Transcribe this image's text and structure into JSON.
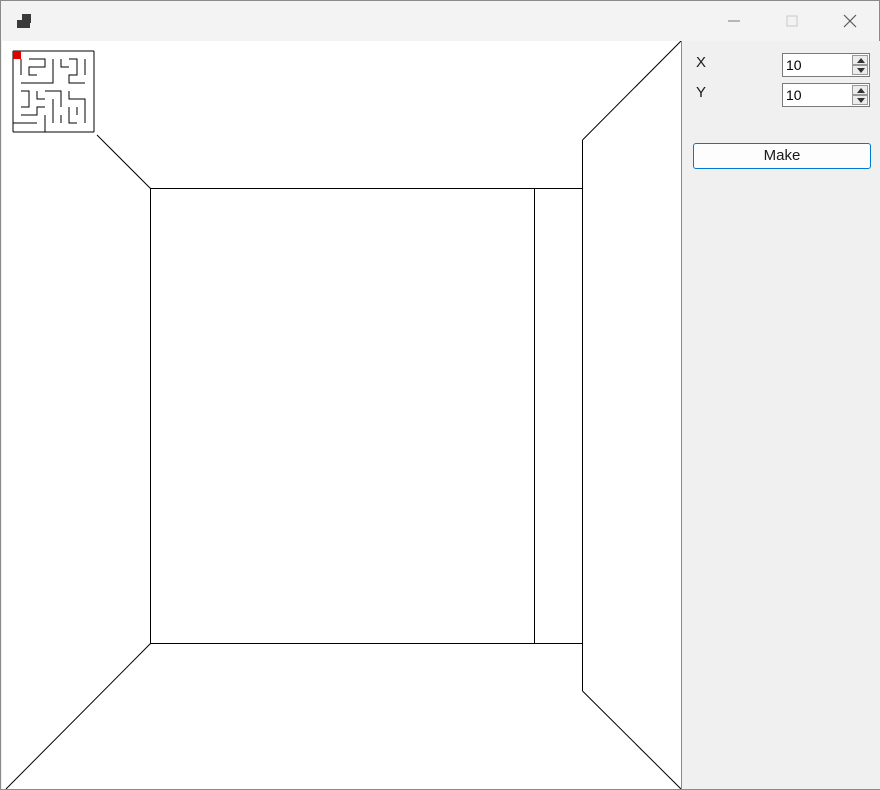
{
  "window": {
    "title": "",
    "controls": {
      "minimize_icon": "minimize-icon",
      "maximize_icon": "maximize-icon",
      "close_icon": "close-icon"
    }
  },
  "panel": {
    "x_label": "X",
    "x_value": "10",
    "y_label": "Y",
    "y_value": "10",
    "make_label": "Make"
  },
  "minimap": {
    "player_color": "#e00000",
    "cols": 10,
    "rows": 10
  },
  "colors": {
    "accent": "#0078d4",
    "line": "#000000"
  }
}
